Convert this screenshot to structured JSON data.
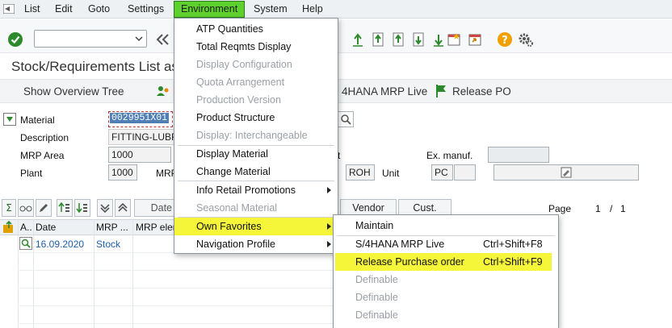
{
  "menubar": {
    "items": [
      {
        "key": "list",
        "label": "List"
      },
      {
        "key": "edit",
        "label": "Edit"
      },
      {
        "key": "goto",
        "label": "Goto"
      },
      {
        "key": "settings",
        "label": "Settings"
      },
      {
        "key": "environment",
        "label": "Environment"
      },
      {
        "key": "system",
        "label": "System"
      },
      {
        "key": "help",
        "label": "Help"
      }
    ]
  },
  "page": {
    "title": "Stock/Requirements List as"
  },
  "app_toolbar": {
    "show_overview_tree": "Show Overview Tree",
    "mrp_live": "4HANA MRP Live",
    "release_po": "Release PO"
  },
  "header": {
    "material_label": "Material",
    "material_value": "0029951X01",
    "description_label": "Description",
    "description_value": "FITTING-LUBR",
    "mrp_area_label": "MRP Area",
    "mrp_area_value": "1000",
    "plant_label": "Plant",
    "plant_value": "1000",
    "mrp_label_partial": "MRP",
    "t_label_partial": "t",
    "ex_manuf_label": "Ex. manuf.",
    "ex_manuf_value": "",
    "type_value": "ROH",
    "unit_label": "Unit",
    "unit_value": "PC"
  },
  "grid": {
    "date_btn": "Date",
    "vendor_btn": "Vendor",
    "cust_btn": "Cust.",
    "page_label": "Page",
    "page_current": "1",
    "page_sep": "/",
    "page_total": "1",
    "columns": [
      "A..",
      "Date",
      "MRP ...",
      "MRP elem"
    ],
    "rows": [
      {
        "date": "16.09.2020",
        "mrp": "Stock"
      }
    ]
  },
  "environment_menu": {
    "items": [
      {
        "label": "ATP Quantities",
        "disabled": false
      },
      {
        "label": "Total Reqmts Display",
        "disabled": false
      },
      {
        "label": "Display Configuration",
        "disabled": true
      },
      {
        "label": "Quota Arrangement",
        "disabled": true
      },
      {
        "label": "Production Version",
        "disabled": true
      },
      {
        "label": "Product Structure",
        "disabled": false
      },
      {
        "label": "Display: Interchangeable",
        "disabled": true
      },
      {
        "label": "Display Material",
        "disabled": false
      },
      {
        "label": "Change Material",
        "disabled": false
      },
      {
        "label": "Info Retail Promotions",
        "disabled": false,
        "submenu": true
      },
      {
        "label": "Seasonal Material",
        "disabled": true
      },
      {
        "label": "Own Favorites",
        "disabled": false,
        "submenu": true,
        "highlighted": true
      },
      {
        "label": "Navigation Profile",
        "disabled": false,
        "submenu": true
      }
    ]
  },
  "favorites_submenu": {
    "items": [
      {
        "label": "Maintain",
        "shortcut": "",
        "disabled": false
      },
      {
        "label": "S/4HANA MRP Live",
        "shortcut": "Ctrl+Shift+F8",
        "disabled": false
      },
      {
        "label": "Release Purchase order",
        "shortcut": "Ctrl+Shift+F9",
        "disabled": false,
        "highlighted": true
      },
      {
        "label": "Definable",
        "shortcut": "",
        "disabled": true
      },
      {
        "label": "Definable",
        "shortcut": "",
        "disabled": true
      },
      {
        "label": "Definable",
        "shortcut": "",
        "disabled": true
      }
    ]
  },
  "colors": {
    "env_highlight": "#5fd12e",
    "menu_highlight": "#f5f53a",
    "green_icon": "#2c8a2c",
    "help_icon": "#f0a000"
  }
}
